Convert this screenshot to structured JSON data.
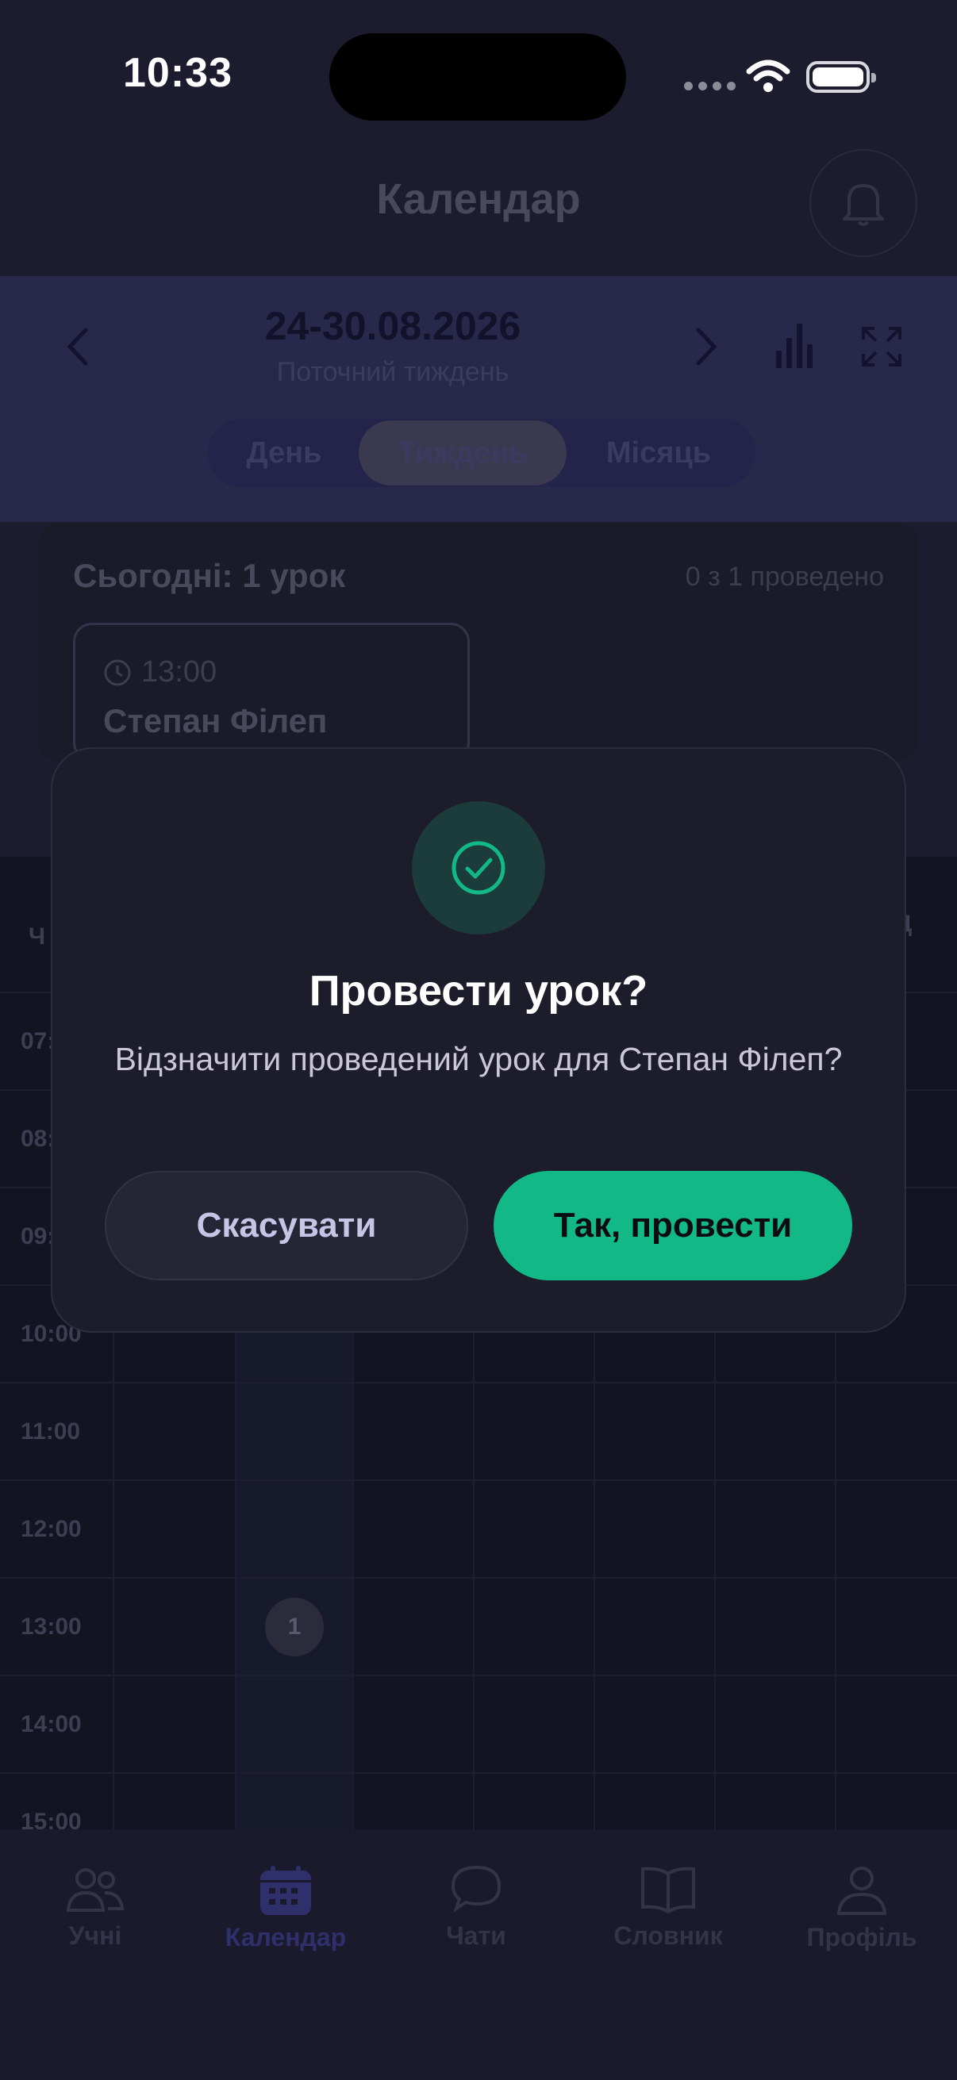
{
  "status_bar": {
    "time": "10:33"
  },
  "header": {
    "title": "Календар"
  },
  "week": {
    "range": "24-30.08.2026",
    "subtitle": "Поточний тиждень",
    "prev_icon": "chevron-left-icon",
    "next_icon": "chevron-right-icon",
    "stats_icon": "bar-chart-icon",
    "expand_icon": "expand-icon",
    "view_tabs": [
      {
        "label": "День",
        "active": false
      },
      {
        "label": "Тиждень",
        "active": true
      },
      {
        "label": "Місяць",
        "active": false
      }
    ]
  },
  "today": {
    "title": "Сьогодні: 1 урок",
    "progress": "0 з 1 проведено",
    "lesson": {
      "time": "13:00",
      "student": "Степан Філеп"
    }
  },
  "grid": {
    "column_fragments": [
      "Ч",
      "Д"
    ],
    "times": [
      "07:00",
      "08:00",
      "09:00",
      "10:00",
      "11:00",
      "12:00",
      "13:00",
      "14:00",
      "15:00"
    ],
    "lesson_marker": "1"
  },
  "tabbar": {
    "items": [
      {
        "label": "Учні",
        "icon": "students-icon",
        "active": false
      },
      {
        "label": "Календар",
        "icon": "calendar-icon",
        "active": true
      },
      {
        "label": "Чати",
        "icon": "chat-icon",
        "active": false
      },
      {
        "label": "Словник",
        "icon": "book-icon",
        "active": false
      },
      {
        "label": "Профіль",
        "icon": "profile-icon",
        "active": false
      }
    ]
  },
  "dialog": {
    "icon": "check-circle-icon",
    "title": "Провести урок?",
    "message": "Відзначити проведений урок для Степан Філеп?",
    "cancel_label": "Скасувати",
    "confirm_label": "Так, провести"
  },
  "colors": {
    "accent_green": "#12b886",
    "background": "#1d1c2e",
    "week_band": "#28284a"
  }
}
